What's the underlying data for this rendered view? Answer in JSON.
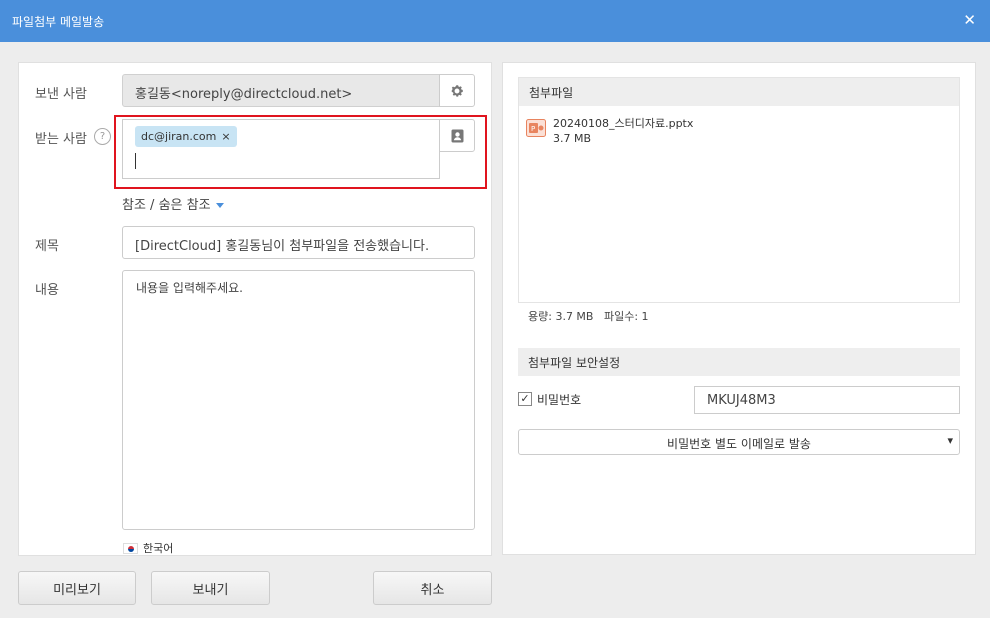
{
  "window": {
    "title": "파일첨부 메일발송",
    "close_glyph": "✕"
  },
  "form": {
    "sender_label": "보낸 사람",
    "sender_value": "홍길동<noreply@directcloud.net>",
    "recipient_label": "받는 사람",
    "help_glyph": "?",
    "recipient_chip": "dc@jiran.com",
    "chip_remove": "×",
    "cc_link": "참조 / 숨은 참조",
    "subject_label": "제목",
    "subject_value": "[DirectCloud] 홍길동님이 첨부파일을 전송했습니다.",
    "content_label": "내용",
    "content_placeholder": "내용을 입력해주세요.",
    "language": "한국어"
  },
  "attachments": {
    "header": "첨부파일",
    "files": [
      {
        "name": "20240108_스터디자료.pptx",
        "size": "3.7 MB"
      }
    ],
    "summary": "용량: 3.7 MB   파일수: 1"
  },
  "security": {
    "header": "첨부파일 보안설정",
    "password_checked": true,
    "check_glyph": "✓",
    "password_label": "비밀번호",
    "password_value": "MKUJ48M3",
    "delivery_option": "비밀번호 별도 이메일로 발송"
  },
  "buttons": {
    "preview": "미리보기",
    "send": "보내기",
    "cancel": "취소"
  },
  "icons": {
    "settings": "gear-icon",
    "address_book": "contact-book-icon",
    "file": "pptx-file-icon"
  },
  "colors": {
    "titlebar": "#4a8fdb",
    "highlight": "#e0141e",
    "chip": "#c8e4f4"
  }
}
